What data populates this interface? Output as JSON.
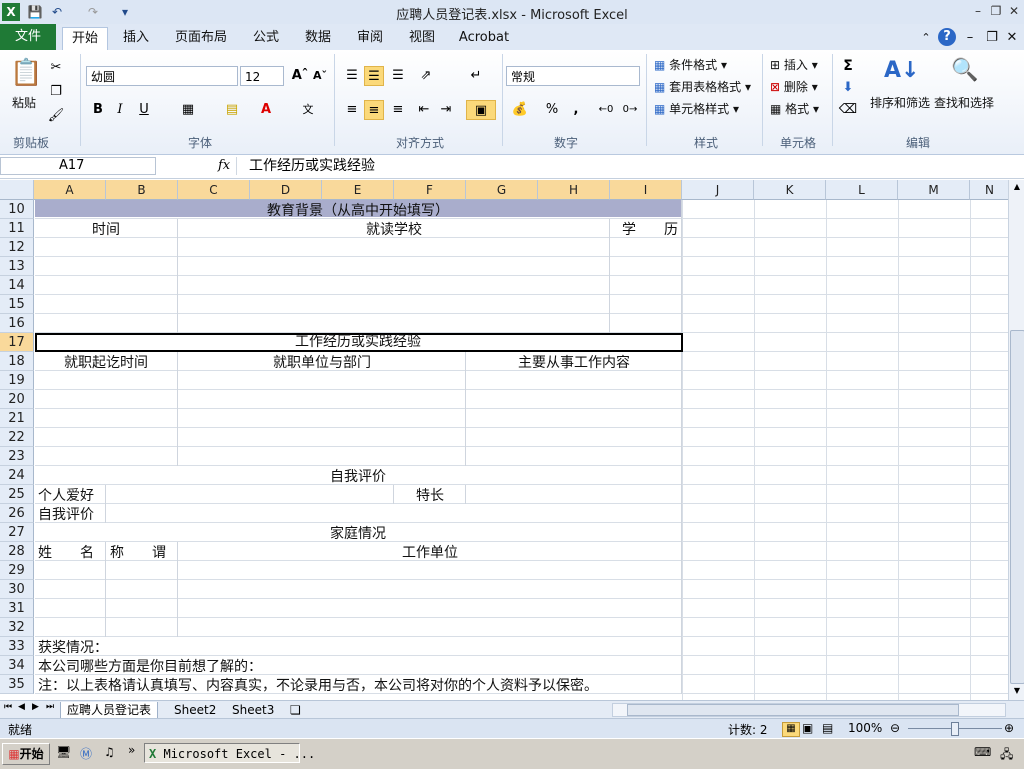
{
  "window": {
    "title": "应聘人员登记表.xlsx - Microsoft Excel"
  },
  "tabs": {
    "file": "文件",
    "items": [
      "开始",
      "插入",
      "页面布局",
      "公式",
      "数据",
      "审阅",
      "视图",
      "Acrobat"
    ]
  },
  "ribbon": {
    "clipboard": {
      "paste": "粘贴",
      "group": "剪贴板"
    },
    "font": {
      "name": "幼圆",
      "size": "12",
      "bold": "B",
      "italic": "I",
      "underline": "U",
      "group": "字体"
    },
    "alignment": {
      "group": "对齐方式"
    },
    "number": {
      "format": "常规",
      "percent": "%",
      "comma": ",",
      "group": "数字"
    },
    "styles": {
      "conditional": "条件格式",
      "table": "套用表格格式",
      "cell": "单元格样式",
      "group": "样式"
    },
    "cells": {
      "insert": "插入",
      "delete": "删除",
      "format": "格式",
      "group": "单元格"
    },
    "editing": {
      "sort": "排序和筛选",
      "find": "查找和选择",
      "group": "编辑",
      "sum": "Σ"
    }
  },
  "formula_bar": {
    "name_box": "A17",
    "fx": "fx",
    "content": "工作经历或实践经验"
  },
  "grid": {
    "columns": [
      "A",
      "B",
      "C",
      "D",
      "E",
      "F",
      "G",
      "H",
      "I",
      "J",
      "K",
      "L",
      "M",
      "N"
    ],
    "rows": [
      "10",
      "11",
      "12",
      "13",
      "14",
      "15",
      "16",
      "17",
      "18",
      "19",
      "20",
      "21",
      "22",
      "23",
      "24",
      "25",
      "26",
      "27",
      "28",
      "29",
      "30",
      "31",
      "32",
      "33",
      "34",
      "35"
    ],
    "cells": {
      "r10": "教育背景（从高中开始填写）",
      "r11_time": "时间",
      "r11_school": "就读学校",
      "r11_degree": "学　　历",
      "r17": "工作经历或实践经验",
      "r18_period": "就职起讫时间",
      "r18_unit": "就职单位与部门",
      "r18_content": "主要从事工作内容",
      "r24": "自我评价",
      "r25_hobby": "个人爱好",
      "r25_skill": "特长",
      "r26": "自我评价",
      "r27": "家庭情况",
      "r28_name": "姓　　名",
      "r28_rel": "称　　谓",
      "r28_work": "工作单位",
      "r33": "获奖情况：",
      "r34": "本公司哪些方面是你目前想了解的：",
      "r35": "注：以上表格请认真填写、内容真实，不论录用与否，本公司将对你的个人资料予以保密。"
    }
  },
  "sheets": [
    "应聘人员登记表",
    "Sheet2",
    "Sheet3"
  ],
  "status": {
    "ready": "就绪",
    "count": "计数: 2",
    "zoom": "100%"
  },
  "taskbar": {
    "start": "开始",
    "app": "Microsoft Excel - ..."
  }
}
